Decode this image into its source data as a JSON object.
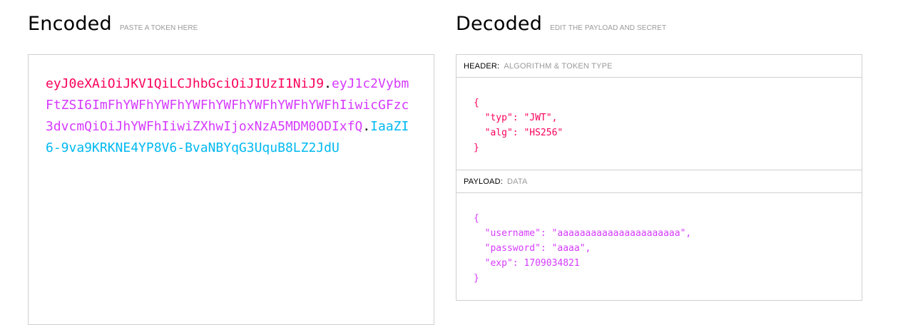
{
  "encoded": {
    "title": "Encoded",
    "subtitle": "PASTE A TOKEN HERE",
    "token": {
      "header": "eyJ0eXAiOiJKV1QiLCJhbGciOiJIUzI1NiJ9",
      "payload": "eyJ1c2VybmFtZSI6ImFhYWFhYWFhYWFhYWFhYWFhYWFhYWFhIiwicGFzc3dvcmQiOiJhYWFhIiwiZXhwIjoxNzA5MDM0ODIxfQ",
      "signature": "IaaZI6-9va9KRKNE4YP8V6-BvaNBYqG3UquB8LZ2JdU",
      "dot": "."
    }
  },
  "decoded": {
    "title": "Decoded",
    "subtitle": "EDIT THE PAYLOAD AND SECRET",
    "header_section": {
      "name": "HEADER:",
      "desc": "ALGORITHM & TOKEN TYPE",
      "lines": [
        "{",
        "  \"typ\": \"JWT\",",
        "  \"alg\": \"HS256\"",
        "}"
      ]
    },
    "payload_section": {
      "name": "PAYLOAD:",
      "desc": "DATA",
      "lines": [
        "{",
        "  \"username\": \"aaaaaaaaaaaaaaaaaaaaaa\",",
        "  \"password\": \"aaaa\",",
        "  \"exp\": 1709034821",
        "}"
      ]
    }
  },
  "colors": {
    "header": "#fb015b",
    "payload": "#d63aff",
    "signature": "#00b9f1"
  }
}
